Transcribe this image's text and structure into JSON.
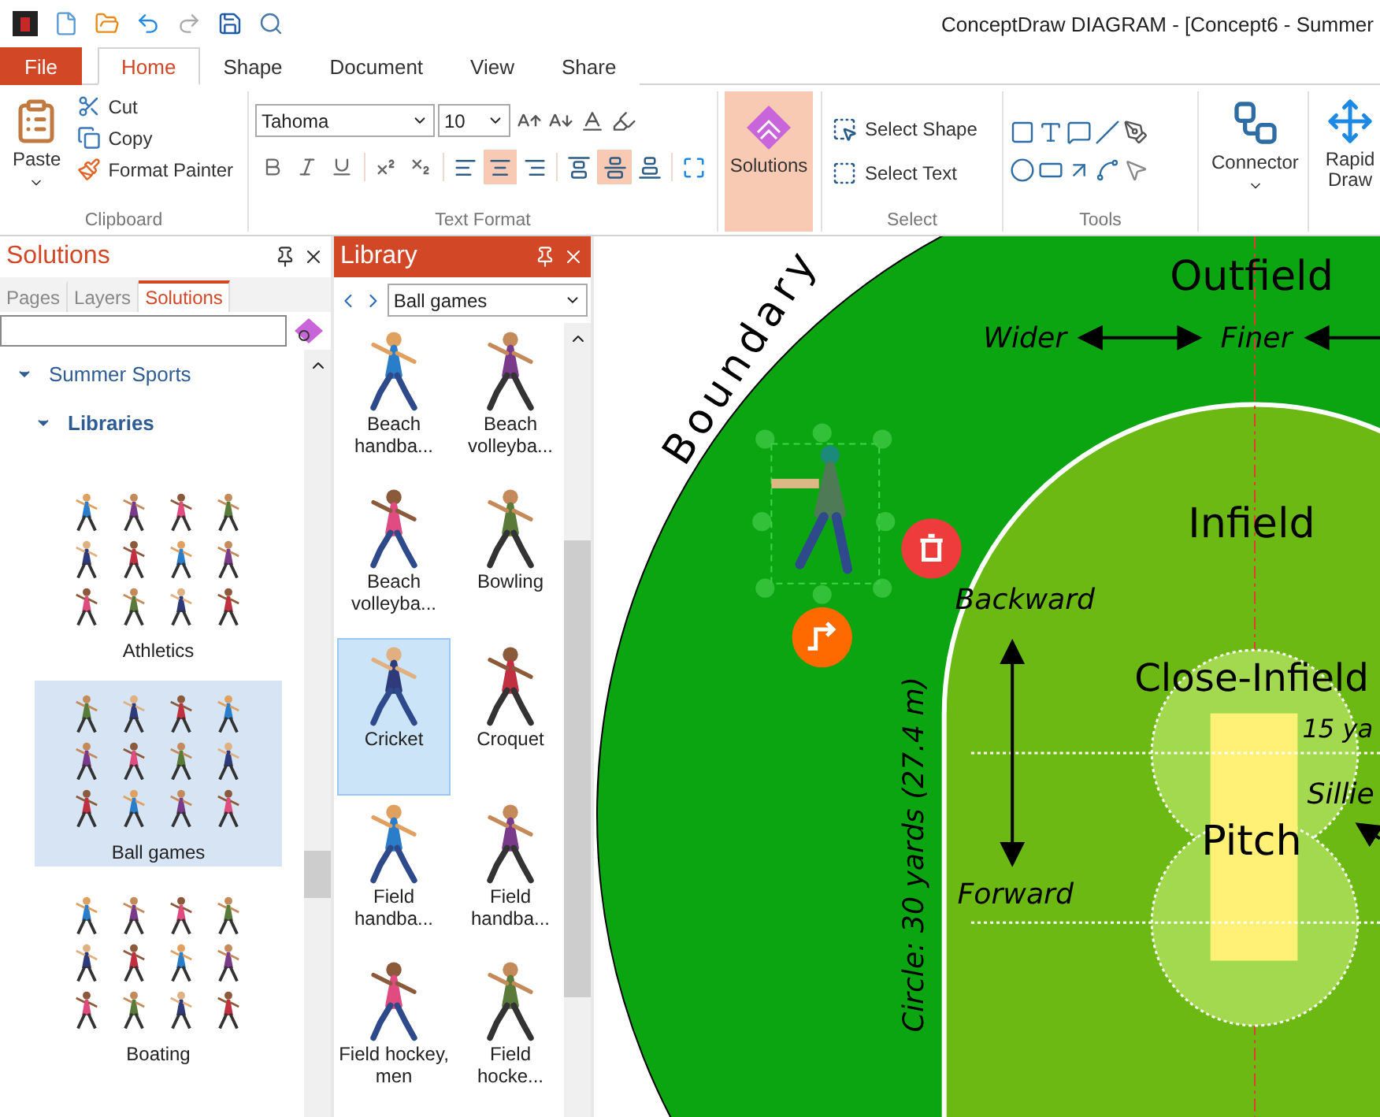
{
  "window": {
    "title": "ConceptDraw DIAGRAM - [Concept6 - Summer"
  },
  "file_tab": "File",
  "ribbon_tabs": [
    {
      "label": "Home",
      "selected": true
    },
    {
      "label": "Shape",
      "selected": false
    },
    {
      "label": "Document",
      "selected": false
    },
    {
      "label": "View",
      "selected": false
    },
    {
      "label": "Share",
      "selected": false
    }
  ],
  "clipboard": {
    "label": "Clipboard",
    "paste": "Paste",
    "items": [
      {
        "kind": "cut",
        "label": "Cut"
      },
      {
        "kind": "copy",
        "label": "Copy"
      },
      {
        "kind": "painter",
        "label": "Format Painter"
      }
    ]
  },
  "text_format": {
    "label": "Text Format",
    "font": "Tahoma",
    "size": "10",
    "horizontal_align": [
      {
        "kind": "left",
        "selected": false
      },
      {
        "kind": "center",
        "selected": true
      },
      {
        "kind": "right",
        "selected": false
      }
    ],
    "vertical_align": [
      {
        "kind": "top",
        "selected": false
      },
      {
        "kind": "middle",
        "selected": true
      },
      {
        "kind": "bottom",
        "selected": false
      }
    ]
  },
  "solutions_button": {
    "label": "Solutions",
    "selected": true
  },
  "select": {
    "label": "Select",
    "items": [
      {
        "kind": "shape",
        "label": "Select Shape"
      },
      {
        "kind": "text",
        "label": "Select Text"
      }
    ]
  },
  "tools": {
    "label": "Tools"
  },
  "connector": {
    "label": "Connector"
  },
  "rapid_draw": {
    "label": "Rapid Draw"
  },
  "solutions_panel": {
    "title": "Solutions",
    "tabs": [
      {
        "label": "Pages",
        "selected": false
      },
      {
        "label": "Layers",
        "selected": false
      },
      {
        "label": "Solutions",
        "selected": true
      }
    ],
    "tree": [
      {
        "label": "Summer Sports",
        "expanded": true,
        "children": [
          {
            "label": "Libraries",
            "expanded": true
          }
        ]
      }
    ],
    "libraries": [
      {
        "label": "Athletics",
        "selected": false
      },
      {
        "label": "Ball games",
        "selected": true
      },
      {
        "label": "Boating",
        "selected": false
      }
    ]
  },
  "library_panel": {
    "title": "Library",
    "dropdown": "Ball games",
    "items": [
      {
        "label": "Beach handba...",
        "selected": false
      },
      {
        "label": "Beach volleyba...",
        "selected": false
      },
      {
        "label": "Beach volleyba...",
        "selected": false
      },
      {
        "label": "Bowling",
        "selected": false
      },
      {
        "label": "Cricket",
        "selected": true
      },
      {
        "label": "Croquet",
        "selected": false
      },
      {
        "label": "Field handba...",
        "selected": false
      },
      {
        "label": "Field handba...",
        "selected": false
      },
      {
        "label": "Field hockey, men",
        "selected": false
      },
      {
        "label": "Field hocke...",
        "selected": false
      }
    ]
  },
  "diagram": {
    "boundary": "Boundary",
    "outfield": "Outfield",
    "wider": "Wider",
    "finer": "Finer",
    "infield": "Infield",
    "backward": "Backward",
    "forward": "Forward",
    "close_infield": "Close-Infield",
    "pitch": "Pitch",
    "circle_label": "Circle: 30 yards (27.4 m)",
    "distance_label": "15 ya",
    "sillier": "Sillie"
  }
}
